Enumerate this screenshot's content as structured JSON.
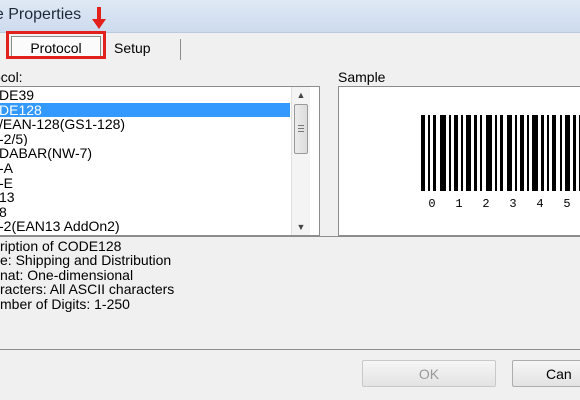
{
  "window": {
    "title": "de Properties"
  },
  "tabs": [
    {
      "label": "Protocol",
      "active": true
    },
    {
      "label": "Setup",
      "active": false
    }
  ],
  "protocol": {
    "label": "ocol:",
    "items": [
      "DE39",
      "DE128",
      "/EAN-128(GS1-128)",
      "-2/5)",
      "DABAR(NW-7)",
      "-A",
      "-E",
      "13",
      "8",
      "-2(EAN13 AddOn2)"
    ],
    "selected_index": 1
  },
  "sample": {
    "label": "Sample",
    "digits": [
      "0",
      "1",
      "2",
      "3",
      "4",
      "5"
    ]
  },
  "description": {
    "lines": [
      "ription of CODE128",
      "e: Shipping and Distribution",
      "nat: One-dimensional",
      "racters: All ASCII characters",
      "mber of Digits: 1-250"
    ]
  },
  "buttons": {
    "ok": "OK",
    "cancel": "Can"
  },
  "colors": {
    "highlight": "#e2201c",
    "selection": "#3399ff"
  }
}
